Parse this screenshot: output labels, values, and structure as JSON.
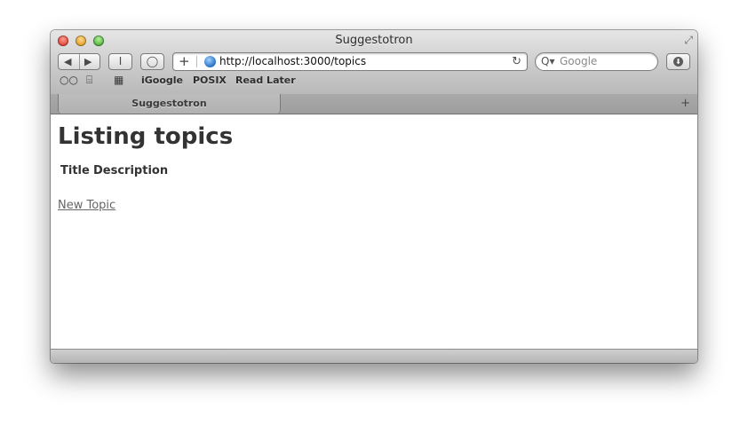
{
  "window": {
    "title": "Suggestotron"
  },
  "toolbar": {
    "back_icon": "◀",
    "forward_icon": "▶",
    "reader_label": "I",
    "bubble_label": "◯",
    "add_bookmark_label": "+",
    "url": "http://localhost:3000/topics",
    "reload_icon": "↻",
    "search_icon": "Q▾",
    "search_placeholder": "Google",
    "download_icon": "⬇"
  },
  "bookmarks": {
    "reading_list_icon": "reading-glasses",
    "bookmarks_icon": "open-book",
    "topsites_icon": "grid",
    "items": [
      {
        "label": "iGoogle"
      },
      {
        "label": "POSIX"
      },
      {
        "label": "Read Later"
      }
    ]
  },
  "tabs": [
    {
      "label": "Suggestotron"
    }
  ],
  "newtab_icon": "+",
  "page": {
    "heading": "Listing topics",
    "table_headers": [
      "Title",
      "Description"
    ],
    "new_topic_link": "New Topic"
  },
  "colors": {
    "heading": "#333333",
    "link": "#666666",
    "chrome": "#c9c9c9"
  }
}
